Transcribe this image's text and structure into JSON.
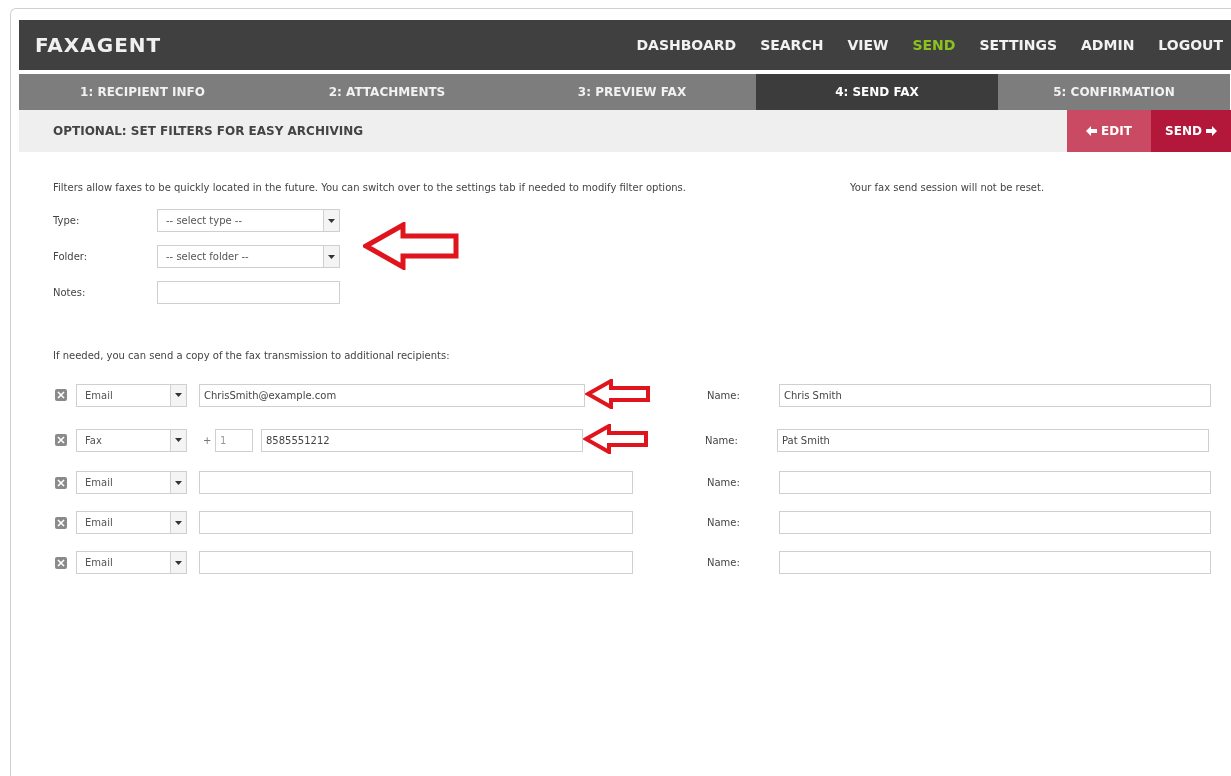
{
  "logo": "FAXAGENT",
  "nav": [
    {
      "label": "DASHBOARD",
      "selected": false
    },
    {
      "label": "SEARCH",
      "selected": false
    },
    {
      "label": "VIEW",
      "selected": false
    },
    {
      "label": "SEND",
      "selected": true
    },
    {
      "label": "SETTINGS",
      "selected": false
    },
    {
      "label": "ADMIN",
      "selected": false
    },
    {
      "label": "LOGOUT",
      "selected": false
    }
  ],
  "steps": [
    {
      "label": "1: RECIPIENT INFO",
      "selected": false
    },
    {
      "label": "2: ATTACHMENTS",
      "selected": false
    },
    {
      "label": "3: PREVIEW FAX",
      "selected": false
    },
    {
      "label": "4: SEND FAX",
      "selected": true
    },
    {
      "label": "5: CONFIRMATION",
      "selected": false
    }
  ],
  "section_title": "OPTIONAL: SET FILTERS FOR EASY ARCHIVING",
  "buttons": {
    "edit": "EDIT",
    "send": "SEND"
  },
  "intro": "Filters allow faxes to be quickly located in the future. You can switch over to the settings tab if needed to modify filter options.",
  "session_note": "Your fax send session will not be reset.",
  "filters": [
    {
      "kind": "select",
      "label": "Type:",
      "value": "-- select type --"
    },
    {
      "kind": "select",
      "label": "Folder:",
      "value": "-- select folder --"
    },
    {
      "kind": "text",
      "label": "Notes:"
    }
  ],
  "copy_note": "If needed, you can send a copy of the fax transmission to additional recipients:",
  "recipients": [
    {
      "kind": "email",
      "type": "Email",
      "address": "ChrisSmith@example.com",
      "name_label": "Name:",
      "name": "Chris Smith"
    },
    {
      "kind": "fax",
      "type": "Fax",
      "plus": "+",
      "country_code": "1",
      "number": "8585551212",
      "name_label": "Name:",
      "name": "Pat Smith"
    },
    {
      "kind": "email",
      "type": "Email",
      "name_label": "Name:"
    },
    {
      "kind": "email",
      "type": "Email",
      "name_label": "Name:"
    },
    {
      "kind": "email",
      "type": "Email",
      "name_label": "Name:"
    }
  ]
}
